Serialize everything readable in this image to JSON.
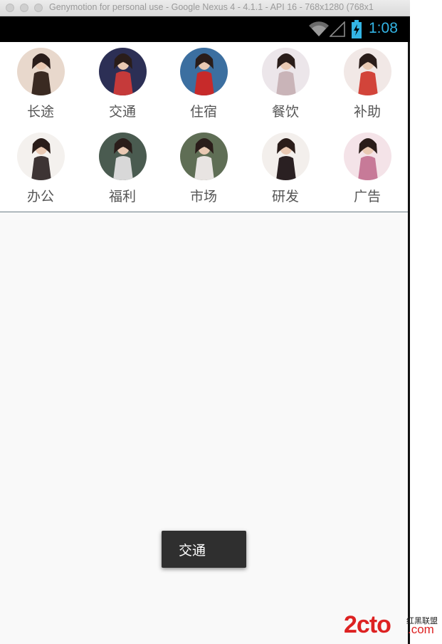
{
  "window": {
    "title": "Genymotion for personal use - Google Nexus 4 - 4.1.1 - API 16 - 768x1280 (768x1"
  },
  "statusbar": {
    "time": "1:08",
    "icons": [
      "wifi-icon",
      "signal-icon",
      "battery-charging-icon"
    ]
  },
  "grid": {
    "items": [
      {
        "label": "长途",
        "avatar": "avatar-photo",
        "bg": "#e8d8cc",
        "fg": "#3a2a22"
      },
      {
        "label": "交通",
        "avatar": "avatar-photo",
        "bg": "#2c2f55",
        "fg": "#c53a3a"
      },
      {
        "label": "住宿",
        "avatar": "avatar-photo",
        "bg": "#3c6fa0",
        "fg": "#c72a2a"
      },
      {
        "label": "餐饮",
        "avatar": "avatar-photo",
        "bg": "#ece6ea",
        "fg": "#c9b4b8"
      },
      {
        "label": "补助",
        "avatar": "avatar-photo",
        "bg": "#f1e8e6",
        "fg": "#d2443a"
      },
      {
        "label": "办公",
        "avatar": "avatar-photo",
        "bg": "#f4f1ee",
        "fg": "#3d3434"
      },
      {
        "label": "福利",
        "avatar": "avatar-photo",
        "bg": "#4a5b50",
        "fg": "#d8d8d8"
      },
      {
        "label": "市场",
        "avatar": "avatar-photo",
        "bg": "#5f6e55",
        "fg": "#e8e4e2"
      },
      {
        "label": "研发",
        "avatar": "avatar-photo",
        "bg": "#f3efec",
        "fg": "#2a2022"
      },
      {
        "label": "广告",
        "avatar": "avatar-photo",
        "bg": "#f4e3e8",
        "fg": "#c77a98"
      }
    ]
  },
  "toast": {
    "text": "交通"
  },
  "watermark": {
    "main": "2cto",
    "top": "红黑联盟",
    "domain": ".com"
  }
}
